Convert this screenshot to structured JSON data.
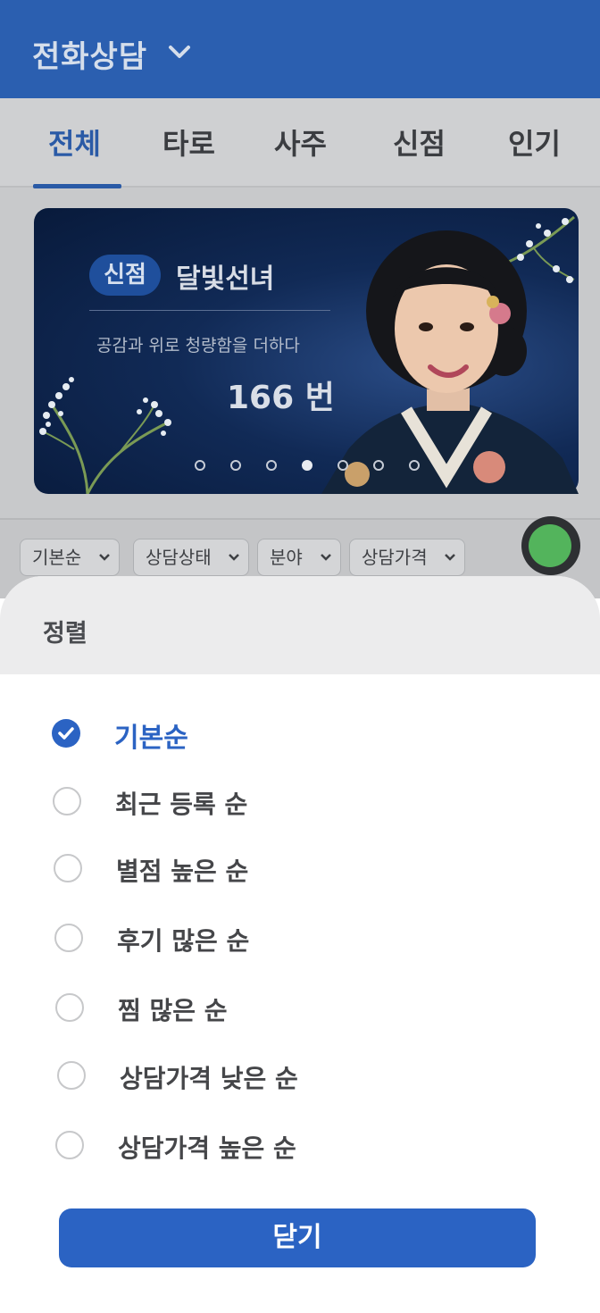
{
  "header": {
    "title": "전화상담",
    "dropdown_icon": "chevron-down-icon"
  },
  "tabs": [
    {
      "label": "전체",
      "active": true
    },
    {
      "label": "타로",
      "active": false
    },
    {
      "label": "사주",
      "active": false
    },
    {
      "label": "신점",
      "active": false
    },
    {
      "label": "인기",
      "active": false
    }
  ],
  "banner": {
    "badge": "신점",
    "name": "달빛선녀",
    "subtitle": "공감과 위로 청량함을 더하다",
    "number": "166 번",
    "slide_count": 7,
    "active_slide": 4
  },
  "filters": [
    {
      "label": "기본순"
    },
    {
      "label": "상담상태"
    },
    {
      "label": "분야"
    },
    {
      "label": "상담가격"
    }
  ],
  "sort_sheet": {
    "title": "정렬",
    "options": [
      {
        "label": "기본순",
        "selected": true
      },
      {
        "label": "최근 등록 순",
        "selected": false
      },
      {
        "label": "별점 높은 순",
        "selected": false
      },
      {
        "label": "후기 많은 순",
        "selected": false
      },
      {
        "label": "찜 많은 순",
        "selected": false
      },
      {
        "label": "상담가격 낮은 순",
        "selected": false
      },
      {
        "label": "상담가격 높은 순",
        "selected": false
      }
    ],
    "close_label": "닫기"
  },
  "colors": {
    "accent": "#2b63c3",
    "header": "#2b5fb0",
    "status_online": "#53b45c"
  }
}
